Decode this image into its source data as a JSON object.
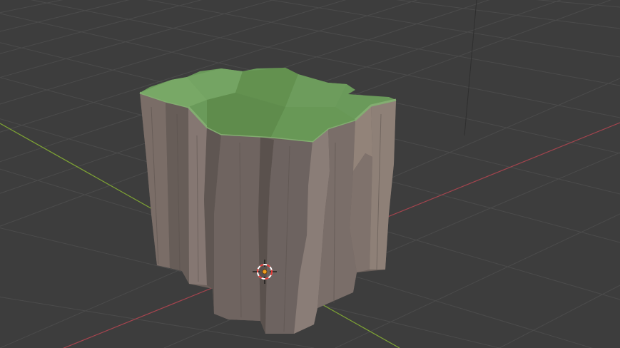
{
  "viewport": {
    "name": "3D Viewport",
    "background_color": "#3d3d3d",
    "grid_color": "#4b4b4b",
    "x_axis_color": "#a5444e",
    "y_axis_color": "#7ea334",
    "z_axis_color": "#2f2f2f"
  },
  "scene_object": {
    "name": "rock-pillar",
    "top_color": "#6a9a5a",
    "top_edge_color": "#83ad71",
    "side_color_dark": "#5e5551",
    "side_color_mid": "#706561",
    "side_color_light": "#85786f"
  },
  "cursor_3d": {
    "name": "3d-cursor",
    "ring_color_a": "#e53935",
    "ring_color_b": "#ffffff",
    "center_color": "#f0a020"
  }
}
